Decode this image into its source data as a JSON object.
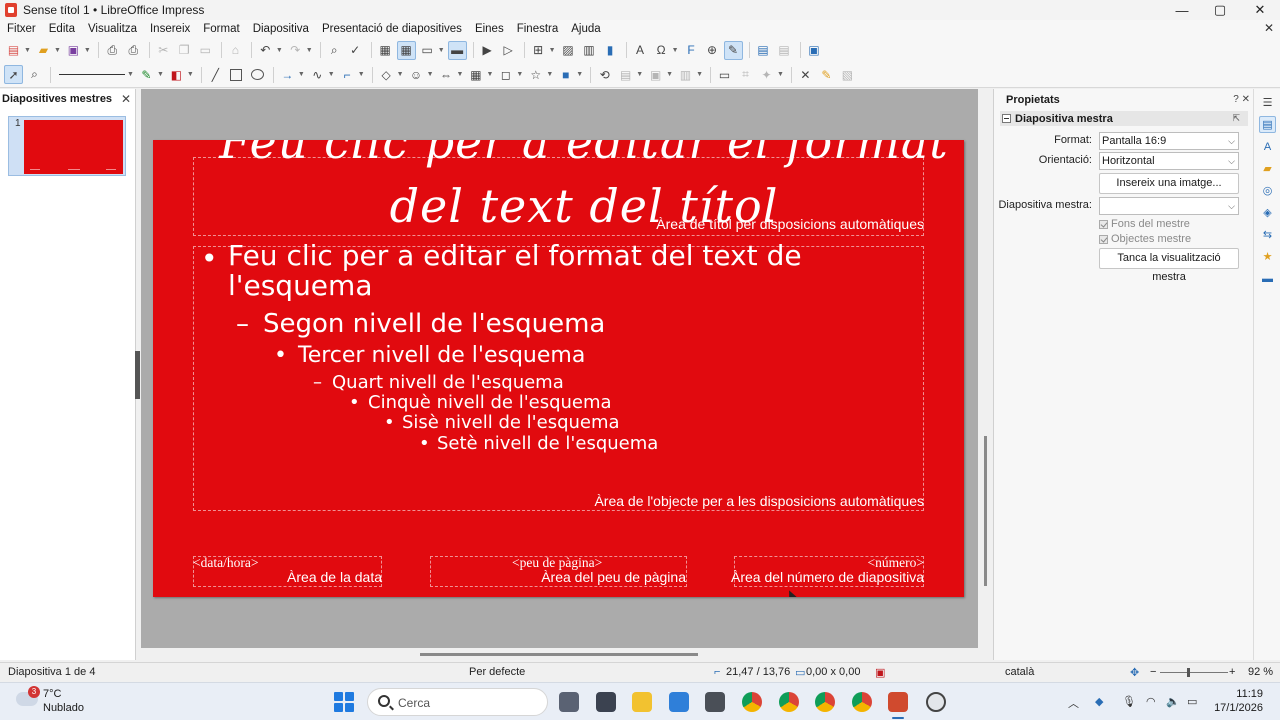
{
  "window": {
    "title": "Sense títol 1 • LibreOffice Impress",
    "controls": {
      "minimize": "—",
      "maximize": "▢",
      "close": "✕"
    }
  },
  "menu": [
    "Fitxer",
    "Edita",
    "Visualitza",
    "Insereix",
    "Format",
    "Diapositiva",
    "Presentació de diapositives",
    "Eines",
    "Finestra",
    "Ajuda"
  ],
  "left_pane": {
    "title": "Diapositives mestres",
    "close": "✕",
    "slide_number": "1"
  },
  "slide": {
    "background_color": "#e10a0f",
    "title_text": "Feu clic per a editar el format del text del títol",
    "title_area_label": "Àrea de títol per disposicions automàtiques",
    "outline": [
      {
        "bullet": "•",
        "text": "Feu clic per a editar el format del text de l'esquema"
      },
      {
        "bullet": "–",
        "text": "Segon nivell de l'esquema"
      },
      {
        "bullet": "•",
        "text": "Tercer nivell de l'esquema"
      },
      {
        "bullet": "–",
        "text": "Quart nivell de l'esquema"
      },
      {
        "bullet": "•",
        "text": "Cinquè nivell de l'esquema"
      },
      {
        "bullet": "•",
        "text": "Sisè nivell de l'esquema"
      },
      {
        "bullet": "•",
        "text": "Setè nivell de l'esquema"
      }
    ],
    "object_area_label": "Àrea de l'objecte per a les disposicions automàtiques",
    "footer": {
      "date_field": "<data/hora>",
      "date_label": "Àrea de la data",
      "footer_field": "<peu de pàgina>",
      "footer_label": "Àrea del peu de pàgina",
      "number_field": "<número>",
      "number_label": "Àrea del número de diapositiva"
    }
  },
  "properties": {
    "title": "Propietats",
    "header_icons": "?  ✕",
    "section": "Diapositiva mestra",
    "format_label": "Format:",
    "format_value": "Pantalla 16:9",
    "orientation_label": "Orientació:",
    "orientation_value": "Horitzontal",
    "insert_image_button": "Insereix una imatge...",
    "master_slide_label": "Diapositiva mestra:",
    "master_slide_value": "",
    "master_background": "Fons del mestre",
    "master_objects": "Objectes mestre",
    "close_master_button": "Tanca la visualització mestra"
  },
  "status": {
    "slide_info": "Diapositiva 1 de 4",
    "layout": "Per defecte",
    "position": "21,47 / 13,76",
    "size": "0,00 x 0,00",
    "language": "català",
    "zoom": "92 %"
  },
  "taskbar": {
    "weather_temp": "7°C",
    "weather_desc": "Nublado",
    "weather_badge": "3",
    "search_placeholder": "Cerca",
    "time": "11:19",
    "date": "17/1/2026"
  },
  "colors": {
    "slide_red": "#e10a0f",
    "accent_blue": "#2a6db5"
  }
}
